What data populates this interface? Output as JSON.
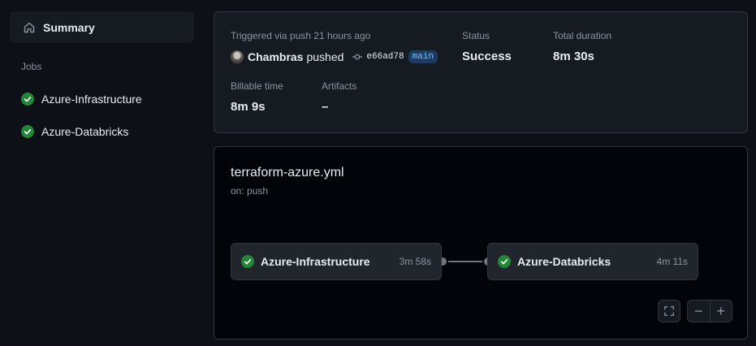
{
  "sidebar": {
    "summary_label": "Summary",
    "jobs_heading": "Jobs",
    "jobs": [
      {
        "label": "Azure-Infrastructure",
        "status": "success"
      },
      {
        "label": "Azure-Databricks",
        "status": "success"
      }
    ]
  },
  "run": {
    "trigger_text": "Triggered via push 21 hours ago",
    "actor": "Chambras",
    "action": "pushed",
    "commit_sha": "e66ad78",
    "branch": "main",
    "status_label": "Status",
    "status_value": "Success",
    "duration_label": "Total duration",
    "duration_value": "8m 30s",
    "billable_label": "Billable time",
    "billable_value": "8m 9s",
    "artifacts_label": "Artifacts",
    "artifacts_value": "–"
  },
  "workflow": {
    "file": "terraform-azure.yml",
    "event": "on: push",
    "jobs": [
      {
        "name": "Azure-Infrastructure",
        "duration": "3m 58s"
      },
      {
        "name": "Azure-Databricks",
        "duration": "4m 11s"
      }
    ],
    "zoom_out": "−",
    "zoom_in": "+"
  },
  "colors": {
    "success": "#3fb950",
    "background": "#0d1117",
    "card": "#161b22",
    "border": "#30363d",
    "link": "#79c0ff"
  }
}
